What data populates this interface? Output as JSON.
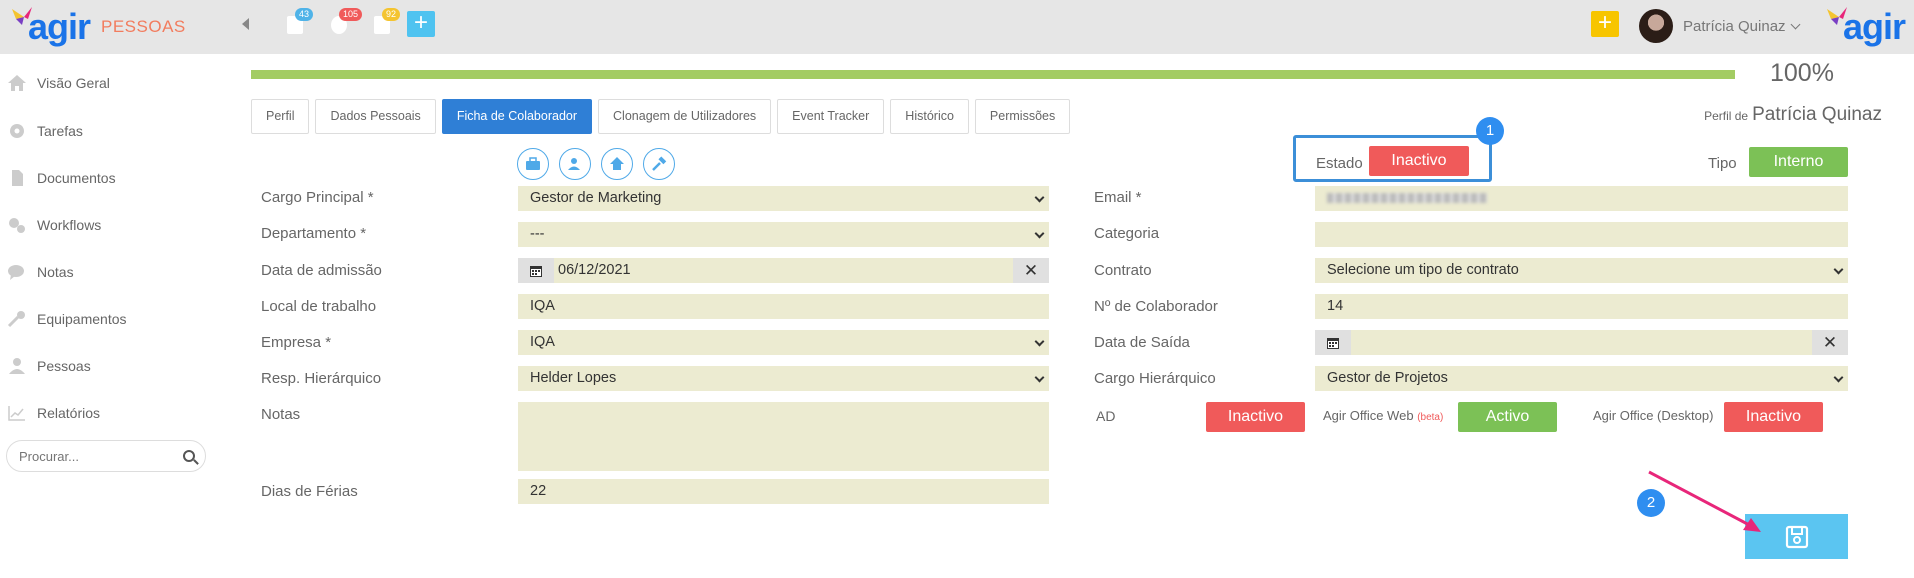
{
  "header": {
    "logo_text": "agir",
    "app_name": "PESSOAS",
    "notifications": [
      {
        "count": "43",
        "color": "#4fb3e8"
      },
      {
        "count": "105",
        "color": "#f05a5a"
      },
      {
        "count": "92",
        "color": "#f4c430"
      }
    ],
    "user_name": "Patrícia Quinaz"
  },
  "sidebar": {
    "items": [
      {
        "label": "Visão Geral",
        "icon": "home-icon"
      },
      {
        "label": "Tarefas",
        "icon": "gear-icon"
      },
      {
        "label": "Documentos",
        "icon": "document-icon"
      },
      {
        "label": "Workflows",
        "icon": "workflow-gears-icon"
      },
      {
        "label": "Notas",
        "icon": "chat-icon"
      },
      {
        "label": "Equipamentos",
        "icon": "wrench-icon"
      },
      {
        "label": "Pessoas",
        "icon": "person-icon"
      },
      {
        "label": "Relatórios",
        "icon": "chart-icon"
      }
    ],
    "search_placeholder": "Procurar..."
  },
  "progress": {
    "value": 1.0,
    "label": "100%",
    "color": "#a3cc63"
  },
  "tabs": [
    {
      "label": "Perfil",
      "active": false
    },
    {
      "label": "Dados Pessoais",
      "active": false
    },
    {
      "label": "Ficha de Colaborador",
      "active": true
    },
    {
      "label": "Clonagem de Utilizadores",
      "active": false
    },
    {
      "label": "Event Tracker",
      "active": false
    },
    {
      "label": "Histórico",
      "active": false
    },
    {
      "label": "Permissões",
      "active": false
    }
  ],
  "profile": {
    "prefix": "Perfil de",
    "name": "Patrícia Quinaz"
  },
  "status": {
    "estado_label": "Estado",
    "estado_value": "Inactivo",
    "tipo_label": "Tipo",
    "tipo_value": "Interno"
  },
  "form_left": {
    "cargo_label": "Cargo Principal *",
    "cargo_value": "Gestor de Marketing",
    "departamento_label": "Departamento *",
    "departamento_value": "---",
    "admissao_label": "Data de admissão",
    "admissao_value": "06/12/2021",
    "local_label": "Local de trabalho",
    "local_value": "IQA",
    "empresa_label": "Empresa *",
    "empresa_value": "IQA",
    "resp_label": "Resp. Hierárquico",
    "resp_value": "Helder Lopes",
    "notas_label": "Notas",
    "notas_value": "",
    "ferias_label": "Dias de Férias",
    "ferias_value": "22"
  },
  "form_right": {
    "email_label": "Email *",
    "categoria_label": "Categoria",
    "categoria_value": "",
    "contrato_label": "Contrato",
    "contrato_value": "Selecione um tipo de contrato",
    "num_label": "Nº de Colaborador",
    "num_value": "14",
    "saida_label": "Data de Saída",
    "saida_value": "",
    "cargo_hier_label": "Cargo Hierárquico",
    "cargo_hier_value": "Gestor de Projetos"
  },
  "integrations": {
    "ad_label": "AD",
    "ad_value": "Inactivo",
    "web_label": "Agir Office Web",
    "web_beta": "(beta)",
    "web_value": "Activo",
    "desktop_label": "Agir Office (Desktop)",
    "desktop_value": "Inactivo"
  },
  "annotations": {
    "step1": "1",
    "step2": "2"
  },
  "colors": {
    "accent": "#2f7fd6",
    "inactive": "#f05a5a",
    "active": "#7cc156",
    "save": "#5bc5f1",
    "annotation_arrow": "#e8267a"
  }
}
